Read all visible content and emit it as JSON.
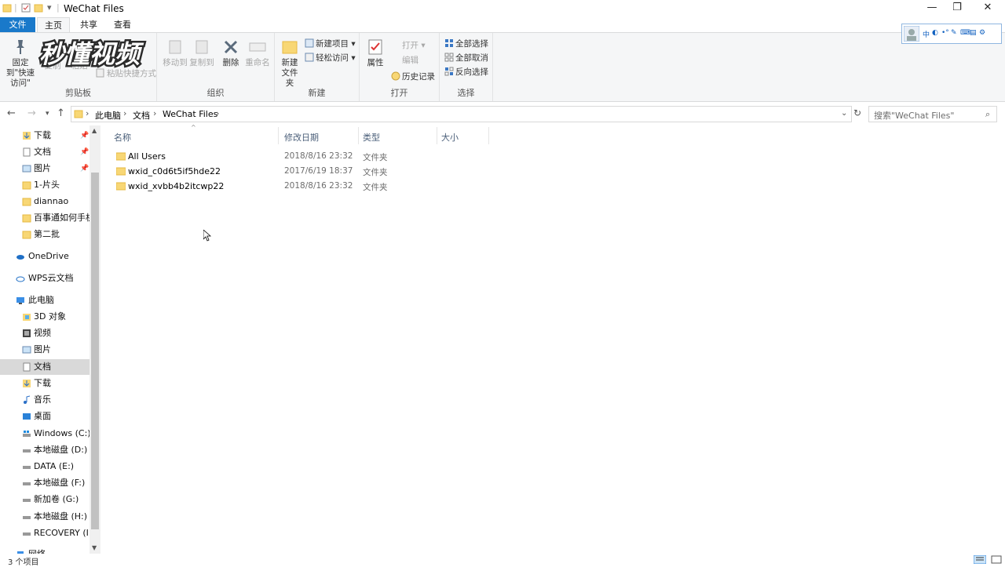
{
  "window": {
    "title": "WeChat Files",
    "minimize": "—",
    "maximize": "❐",
    "close": "✕"
  },
  "ribbon_tabs": [
    "文件",
    "主页",
    "共享",
    "查看"
  ],
  "watermark": {
    "text": "秒懂视频"
  },
  "ribbon": {
    "clipboard": {
      "label": "剪贴板",
      "pin": "固定到\"快速访问\"",
      "copy": "复制",
      "paste": "粘贴",
      "cut": "剪切",
      "copy_path": "复制路径",
      "paste_shortcut": "粘贴快捷方式"
    },
    "organize": {
      "label": "组织",
      "move_to": "移动到",
      "copy_to": "复制到",
      "delete": "删除",
      "rename": "重命名"
    },
    "new": {
      "label": "新建",
      "new_folder": "新建文件夹",
      "new_item": "新建项目",
      "easy_access": "轻松访问"
    },
    "open": {
      "label": "打开",
      "properties": "属性",
      "open": "打开",
      "edit": "编辑",
      "history": "历史记录"
    },
    "select": {
      "label": "选择",
      "select_all": "全部选择",
      "select_none": "全部取消",
      "invert": "反向选择"
    }
  },
  "ime": {
    "items": [
      "中",
      "◐",
      "•°",
      "✎",
      "⌨",
      "▤",
      "⚙"
    ]
  },
  "address": {
    "crumbs": [
      "此电脑",
      "文档",
      "WeChat Files"
    ],
    "search_placeholder": "搜索\"WeChat Files\""
  },
  "nav_pane": {
    "quick_access": [
      {
        "label": "下载",
        "pinned": true
      },
      {
        "label": "文档",
        "pinned": true
      },
      {
        "label": "图片",
        "pinned": true
      },
      {
        "label": "1-片头",
        "pinned": false
      },
      {
        "label": "diannao",
        "pinned": false
      },
      {
        "label": "百事通如何手机",
        "pinned": false
      },
      {
        "label": "第二批",
        "pinned": false
      }
    ],
    "onedrive": "OneDrive",
    "wps": "WPS云文档",
    "this_pc": "此电脑",
    "pc_items": [
      "3D 对象",
      "视频",
      "图片",
      "文档",
      "下载",
      "音乐",
      "桌面"
    ],
    "drives": [
      "Windows (C:)",
      "本地磁盘 (D:)",
      "DATA (E:)",
      "本地磁盘 (F:)",
      "新加卷 (G:)",
      "本地磁盘 (H:)",
      "RECOVERY (I:)"
    ],
    "network": "网络"
  },
  "columns": {
    "name": "名称",
    "date": "修改日期",
    "type": "类型",
    "size": "大小"
  },
  "files": [
    {
      "name": "All Users",
      "date": "2018/8/16 23:32",
      "type": "文件夹"
    },
    {
      "name": "wxid_c0d6t5if5hde22",
      "date": "2017/6/19 18:37",
      "type": "文件夹"
    },
    {
      "name": "wxid_xvbb4b2itcwp22",
      "date": "2018/8/16 23:32",
      "type": "文件夹"
    }
  ],
  "status": {
    "count": "3 个项目"
  },
  "colors": {
    "accent": "#1979ca",
    "folder": "#f8d775",
    "folder_dark": "#e6b842"
  }
}
